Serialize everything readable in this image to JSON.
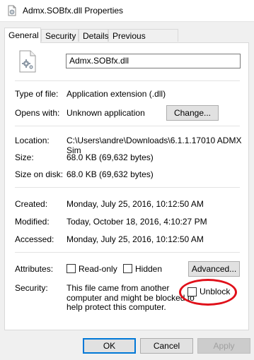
{
  "window": {
    "title": "Admx.SOBfx.dll Properties",
    "icon": "document-gear-icon"
  },
  "tabs": [
    {
      "label": "General",
      "active": true
    },
    {
      "label": "Security",
      "active": false
    },
    {
      "label": "Details",
      "active": false
    },
    {
      "label": "Previous Versions",
      "active": false
    }
  ],
  "general": {
    "file_icon": "dll-file-gear-icon",
    "file_name": "Admx.SOBfx.dll",
    "type_label": "Type of file:",
    "type_value": "Application extension (.dll)",
    "opens_label": "Opens with:",
    "opens_value": "Unknown application",
    "change_button": "Change...",
    "location_label": "Location:",
    "location_value": "C:\\Users\\andre\\Downloads\\6.1.1.17010 ADMX Sim",
    "size_label": "Size:",
    "size_value": "68.0 KB (69,632 bytes)",
    "size_on_disk_label": "Size on disk:",
    "size_on_disk_value": "68.0 KB (69,632 bytes)",
    "created_label": "Created:",
    "created_value": "Monday, July 25, 2016, 10:12:50 AM",
    "modified_label": "Modified:",
    "modified_value": "Today, October 18, 2016, 4:10:27 PM",
    "accessed_label": "Accessed:",
    "accessed_value": "Monday, July 25, 2016, 10:12:50 AM",
    "attributes_label": "Attributes:",
    "readonly_label": "Read-only",
    "readonly_checked": false,
    "hidden_label": "Hidden",
    "hidden_checked": false,
    "advanced_button": "Advanced...",
    "security_label": "Security:",
    "security_text_1": "This file came from another",
    "security_text_2": "computer and might be blocked to",
    "security_text_3": "help protect this computer.",
    "unblock_label": "Unblock",
    "unblock_checked": false,
    "highlight_color": "#e0101a"
  },
  "footer": {
    "ok": "OK",
    "cancel": "Cancel",
    "apply": "Apply"
  }
}
